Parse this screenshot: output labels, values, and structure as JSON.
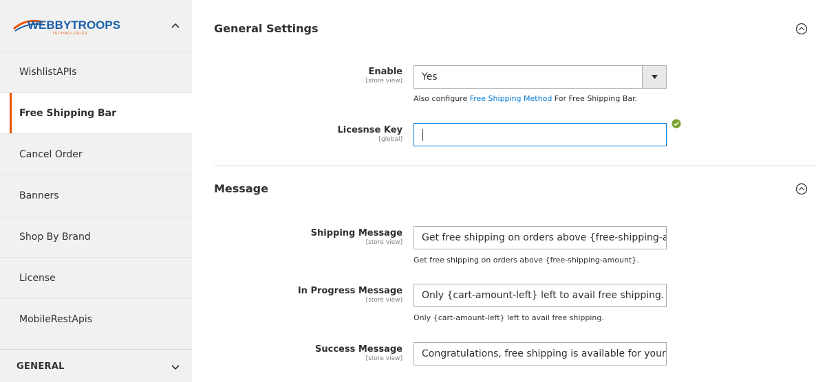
{
  "sidebar": {
    "logo_text": "WEBBYTROOPS",
    "logo_sub": "TECHNOLOGIES",
    "items": [
      {
        "label": "WishlistAPIs",
        "active": false
      },
      {
        "label": "Free Shipping Bar",
        "active": true
      },
      {
        "label": "Cancel Order",
        "active": false
      },
      {
        "label": "Banners",
        "active": false
      },
      {
        "label": "Shop By Brand",
        "active": false
      },
      {
        "label": "License",
        "active": false
      },
      {
        "label": "MobileRestApis",
        "active": false
      }
    ],
    "general_label": "GENERAL"
  },
  "general_settings": {
    "title": "General Settings",
    "enable": {
      "label": "Enable",
      "scope": "[store view]",
      "value": "Yes",
      "note_before": "Also configure ",
      "note_link": "Free Shipping Method",
      "note_after": " For Free Shipping Bar."
    },
    "license": {
      "label": "Licesnse Key",
      "scope": "[global]",
      "value": ""
    }
  },
  "message": {
    "title": "Message",
    "shipping": {
      "label": "Shipping Message",
      "scope": "[store view]",
      "value": "Get free shipping on orders above {free-shipping-amount}.",
      "note": "Get free shipping on orders above {free-shipping-amount}."
    },
    "in_progress": {
      "label": "In Progress Message",
      "scope": "[store view]",
      "value": "Only {cart-amount-left} left to avail free shipping.",
      "note": "Only {cart-amount-left} left to avail free shipping."
    },
    "success": {
      "label": "Success Message",
      "scope": "[store view]",
      "value": "Congratulations, free shipping is available for your order."
    }
  },
  "colors": {
    "accent": "#eb5202",
    "link": "#007bdb",
    "sidebar_bg": "#f1f1f1",
    "valid": "#79a22e"
  }
}
